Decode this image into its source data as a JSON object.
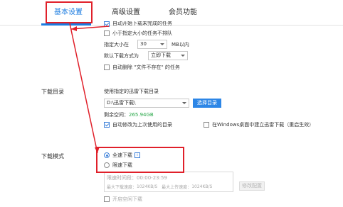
{
  "tabs": [
    {
      "label": "基本设置",
      "active": true
    },
    {
      "label": "高级设置",
      "active": false
    },
    {
      "label": "会员功能",
      "active": false
    }
  ],
  "task_options": {
    "partial_top_label": "自动开始下载未完成的任务",
    "skip_small_label": "小于指定大小的任务不排队",
    "size_label": "指定大小在",
    "size_value": "30",
    "size_unit": "MB以内",
    "default_method_label": "默认下载方式为",
    "default_method_value": "立即下载",
    "auto_delete_label": "自动删除 \"文件不存在\" 的任务"
  },
  "download_dir": {
    "section_label": "下载目录",
    "use_specified_label": "使用指定的迅雷下载目录",
    "path_value": "D:\\迅雷下载\\",
    "choose_button": "选择目录",
    "free_space_label": "剩余空间：",
    "free_space_value": "265.94GB",
    "auto_modify_label": "自动修改为上次使用的目录",
    "windows_shortcut_label": "在Windows桌面中建立迅雷下载（重启生效）"
  },
  "download_mode": {
    "section_label": "下载模式",
    "full_speed_label": "全速下载",
    "info_icon_text": "i",
    "limited_label": "限速下载",
    "time_label": "限速时间段：00:00-23:59",
    "max_download_label": "最大下载速度：",
    "max_download_value": "1024KB/S",
    "max_upload_label": "最大上传速度：",
    "max_upload_value": "1024KB/S",
    "modify_button": "修改配置",
    "idle_download_label": "开启空闲下载"
  },
  "colors": {
    "accent": "#1a7be0",
    "highlight": "#e0202a",
    "free_space": "#2aa84a"
  }
}
